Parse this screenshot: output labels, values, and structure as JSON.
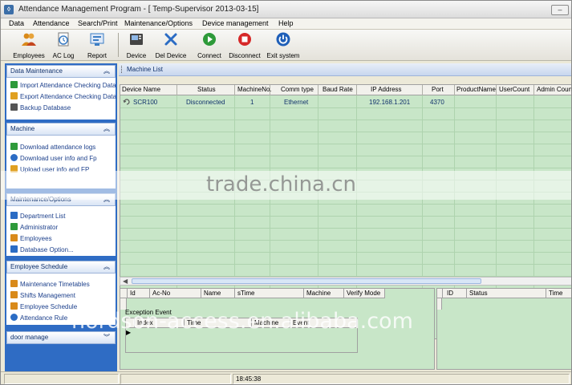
{
  "window": {
    "title": "Attendance Management Program - [ Temp-Supervisor 2013-03-15]"
  },
  "menu": [
    {
      "id": "data",
      "label": "Data"
    },
    {
      "id": "attendance",
      "label": "Attendance"
    },
    {
      "id": "search",
      "label": "Search/Print"
    },
    {
      "id": "maintenance",
      "label": "Maintenance/Options"
    },
    {
      "id": "device",
      "label": "Device management"
    },
    {
      "id": "help",
      "label": "Help"
    }
  ],
  "toolbar": [
    {
      "id": "employees",
      "label": "Employees",
      "icon": "employees-icon",
      "color": "#d98a1a"
    },
    {
      "id": "ac-log",
      "label": "AC Log",
      "icon": "ac-log-icon",
      "color": "#3b7dc4"
    },
    {
      "id": "report",
      "label": "Report",
      "icon": "report-icon",
      "color": "#3b7dc4"
    },
    {
      "id": "device",
      "label": "Device",
      "icon": "device-icon",
      "color": "#333333"
    },
    {
      "id": "del-device",
      "label": "Del Device",
      "icon": "del-device-icon",
      "color": "#2b6cc4"
    },
    {
      "id": "connect",
      "label": "Connect",
      "icon": "connect-icon",
      "color": "#2e9a3a"
    },
    {
      "id": "disconnect",
      "label": "Disconnect",
      "icon": "disconnect-icon",
      "color": "#d62828"
    },
    {
      "id": "exit",
      "label": "Exit system",
      "icon": "power-icon",
      "color": "#1f5fb8"
    }
  ],
  "sidebar": {
    "data_maintenance": {
      "title": "Data Maintenance",
      "items": [
        {
          "label": "Import Attendance Checking Data",
          "icon": "import-icon",
          "color": "#2e9a3a"
        },
        {
          "label": "Export Attendance Checking Data",
          "icon": "export-icon",
          "color": "#e0a020"
        },
        {
          "label": "Backup Database",
          "icon": "database-icon",
          "color": "#555555"
        }
      ]
    },
    "machine": {
      "title": "Machine",
      "items": [
        {
          "label": "Download attendance logs",
          "icon": "download-icon",
          "color": "#2e9a3a"
        },
        {
          "label": "Download user info and Fp",
          "icon": "download-user-icon",
          "color": "#2b6cc4"
        },
        {
          "label": "Upload user info and FP",
          "icon": "upload-icon",
          "color": "#e0a020"
        }
      ]
    },
    "maintenance_options": {
      "title": "Maintenance/Options",
      "items": [
        {
          "label": "Department List",
          "icon": "department-icon",
          "color": "#2b6cc4"
        },
        {
          "label": "Administrator",
          "icon": "administrator-icon",
          "color": "#2e9a3a"
        },
        {
          "label": "Employees",
          "icon": "employees-icon",
          "color": "#d98a1a"
        },
        {
          "label": "Database Option...",
          "icon": "database-option-icon",
          "color": "#2b6cc4"
        }
      ]
    },
    "employee_schedule": {
      "title": "Employee Schedule",
      "items": [
        {
          "label": "Maintenance Timetables",
          "icon": "timetable-icon",
          "color": "#d98a1a"
        },
        {
          "label": "Shifts Management",
          "icon": "shift-icon",
          "color": "#d98a1a"
        },
        {
          "label": "Employee Schedule",
          "icon": "schedule-icon",
          "color": "#d98a1a"
        },
        {
          "label": "Attendance Rule",
          "icon": "rule-icon",
          "color": "#2b6cc4"
        }
      ]
    },
    "door_manage": {
      "title": "door manage"
    }
  },
  "machine_list": {
    "title": "Machine List",
    "columns": [
      "Device Name",
      "Status",
      "MachineNo.",
      "Comm type",
      "Baud Rate",
      "IP Address",
      "Port",
      "ProductName",
      "UserCount",
      "Admin Count"
    ],
    "rows": [
      [
        "SCR100",
        "Disconnected",
        "1",
        "Ethernet",
        "",
        "192.168.1.201",
        "4370",
        "",
        "",
        ""
      ]
    ]
  },
  "log_table": {
    "columns": [
      "Id",
      "Ac-No",
      "Name",
      "sTime",
      "Machine",
      "Verify Mode"
    ]
  },
  "event_section": {
    "title": "Exception Event",
    "columns": [
      "Index",
      "Time",
      "Machine",
      "Event"
    ]
  },
  "side_table": {
    "columns": [
      "ID",
      "Status",
      "Time"
    ]
  },
  "statusbar": {
    "time": "18:45:38"
  },
  "watermarks": [
    "trade.china.cn",
    "nordson-access.en.alibaba.com"
  ]
}
